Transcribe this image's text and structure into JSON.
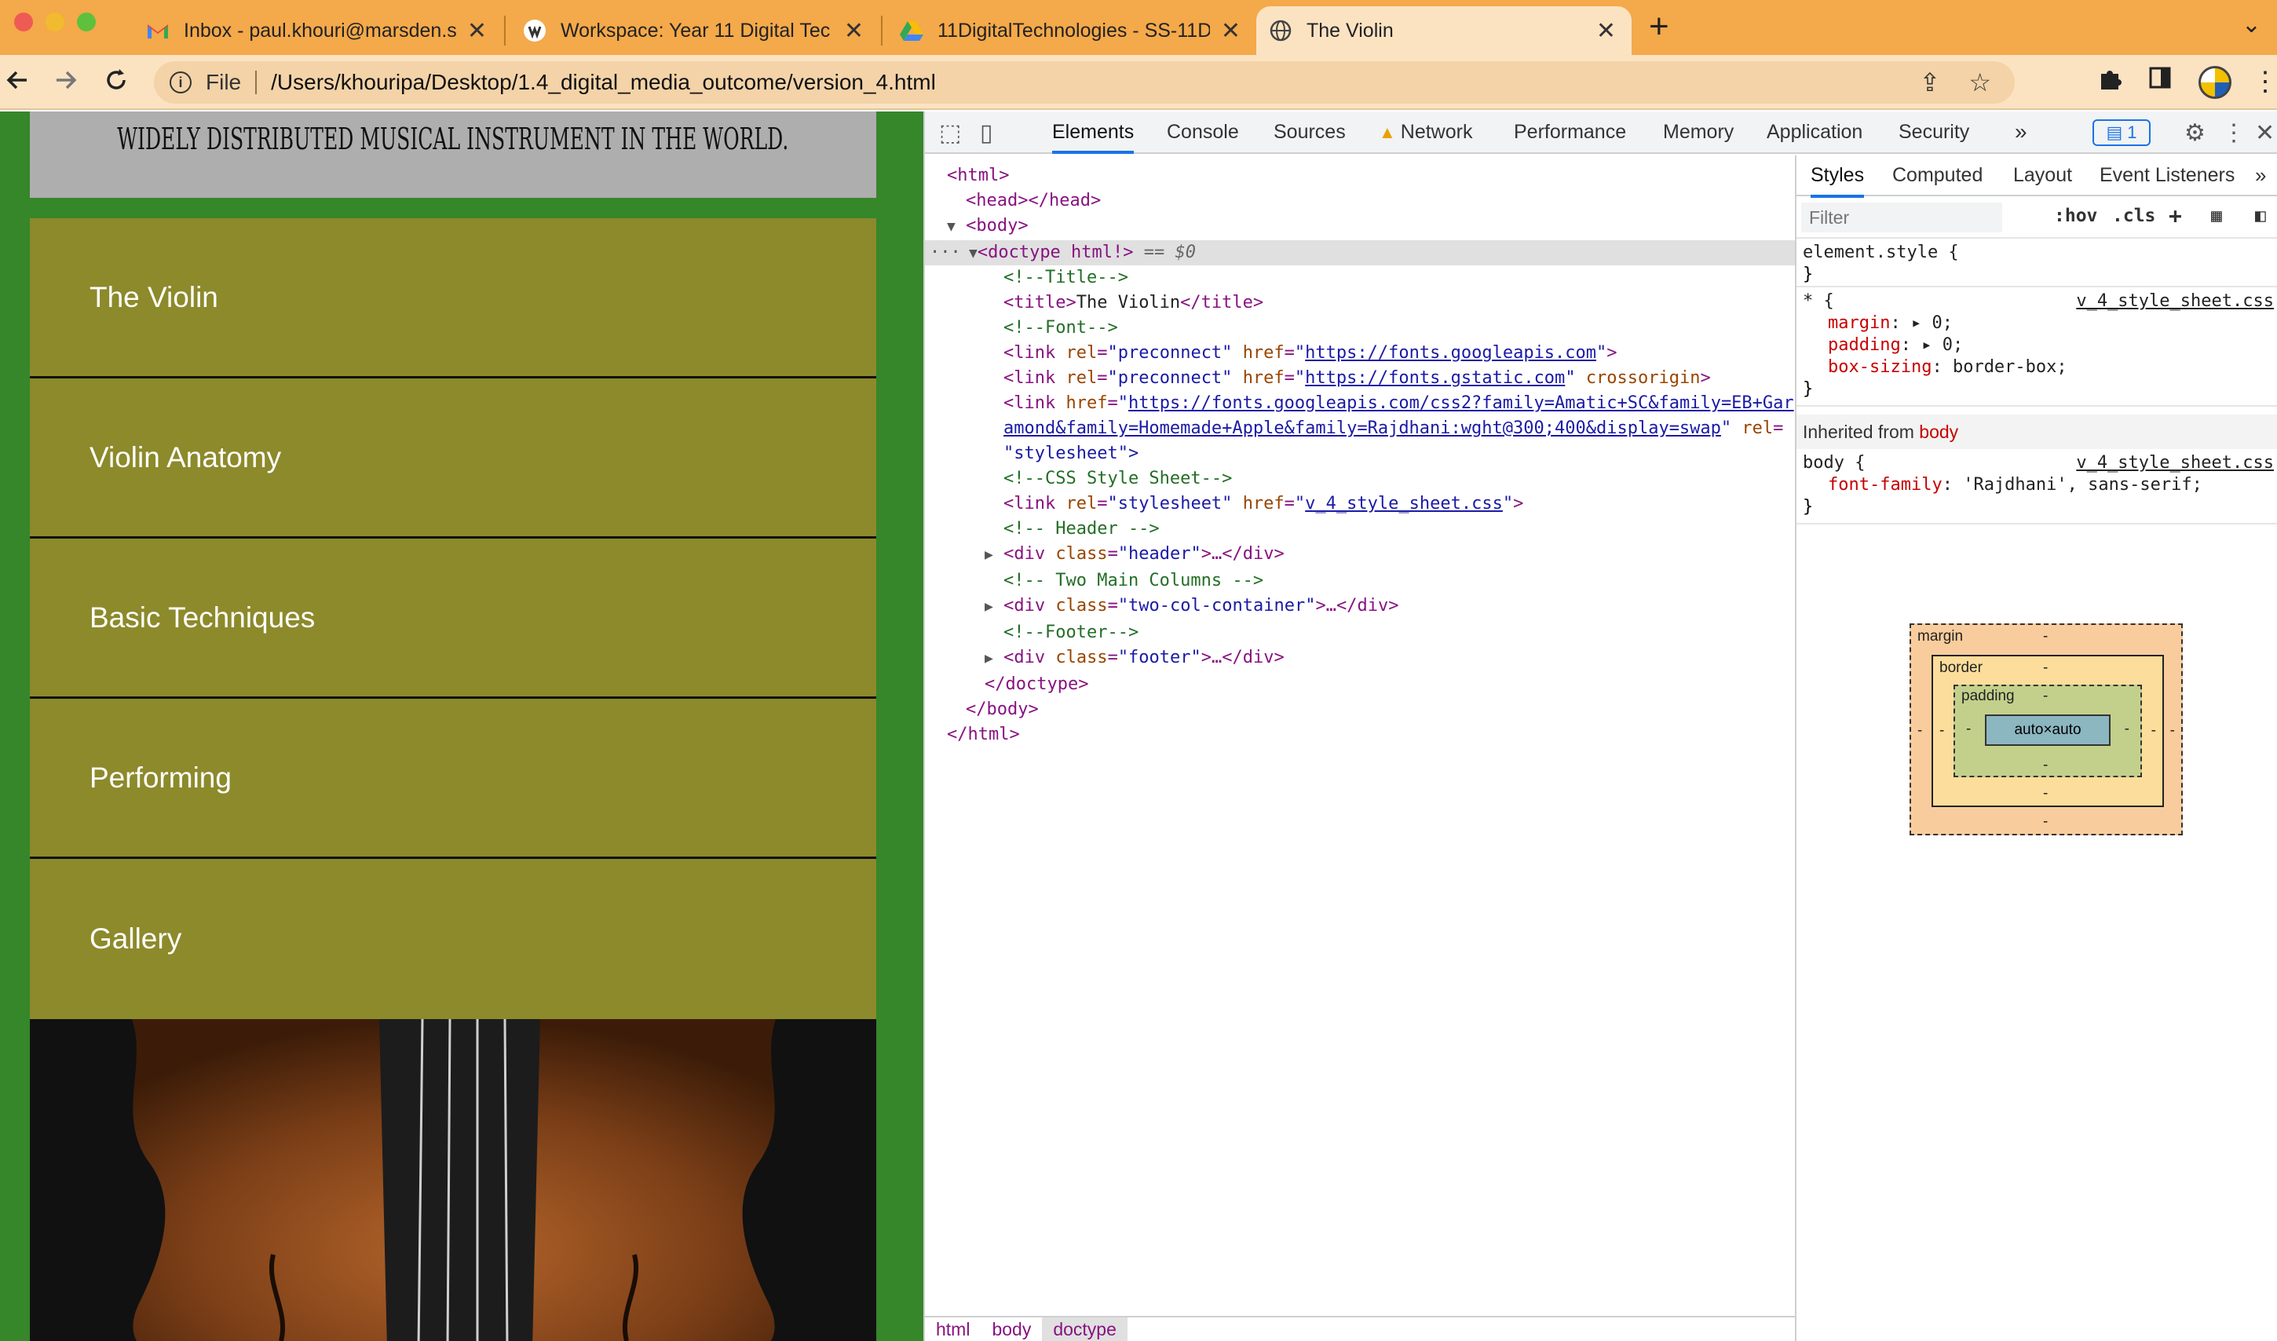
{
  "browser": {
    "tabs": [
      {
        "title": "Inbox - paul.khouri@marsden.s",
        "icon": "gmail-icon"
      },
      {
        "title": "Workspace: Year 11 Digital Tec",
        "icon": "workspace-icon"
      },
      {
        "title": "11DigitalTechnologies - SS-11D",
        "icon": "google-drive-icon"
      },
      {
        "title": "The Violin",
        "icon": "globe-icon"
      }
    ],
    "close_glyph": "✕",
    "new_tab_glyph": "+",
    "address": {
      "scheme_label": "File",
      "url": "/Users/khouripa/Desktop/1.4_digital_media_outcome/version_4.html"
    }
  },
  "page": {
    "header_text": "WIDELY DISTRIBUTED MUSICAL INSTRUMENT IN THE WORLD.",
    "nav_items": [
      "The Violin",
      "Violin Anatomy",
      "Basic Techniques",
      "Performing",
      "Gallery"
    ],
    "colors": {
      "background": "#36862a",
      "nav": "#8c8a2b",
      "header": "#aeaeae"
    }
  },
  "devtools": {
    "tabs": [
      "Elements",
      "Console",
      "Sources",
      "Network",
      "Performance",
      "Memory",
      "Application",
      "Security"
    ],
    "active_tab": "Elements",
    "more_tabs": "»",
    "issues_count": "1",
    "dom_lines": {
      "l1": "<html>",
      "l2": "<head></head>",
      "l3": "<body>",
      "l4_tag": "<doctype html!>",
      "l4_eq": "== $0",
      "l5": "<!--Title-->",
      "l6_open": "<title>",
      "l6_text": "The Violin",
      "l6_close": "</title>",
      "l7": "<!--Font-->",
      "l8_href": "https://fonts.googleapis.com",
      "l9_href": "https://fonts.gstatic.com",
      "l10_href_a": "https://fonts.googleapis.com/css2?family=Amatic+SC&family=EB+Gar",
      "l10_href_b": "amond&family=Homemade+Apple&family=Rajdhani:wght@300;400&display=swap",
      "l10_rel": "\"stylesheet\">",
      "l11": "<!--CSS Style Sheet-->",
      "l12_href": "v_4_style_sheet.css",
      "l13": "<!-- Header -->",
      "l14_class": "\"header\"",
      "l15": "<!-- Two Main Columns -->",
      "l16_class": "\"two-col-container\"",
      "l17": "<!--Footer-->",
      "l18_class": "\"footer\"",
      "l19": "</doctype>",
      "l20": "</body>",
      "l21": "</html>"
    },
    "breadcrumbs": [
      "html",
      "body",
      "doctype"
    ],
    "styles": {
      "tabs": [
        "Styles",
        "Computed",
        "Layout",
        "Event Listeners"
      ],
      "filter_placeholder": "Filter",
      "hov": ":hov",
      "cls": ".cls",
      "element_style": "element.style {",
      "universal_selector": "* {",
      "source": "v_4_style_sheet.css",
      "props": [
        {
          "name": "margin",
          "value": "0;"
        },
        {
          "name": "padding",
          "value": "0;"
        },
        {
          "name": "box-sizing",
          "value": "border-box;"
        }
      ],
      "inherited_label": "Inherited from",
      "inherited_from": "body",
      "body_selector": "body {",
      "body_prop": {
        "name": "font-family",
        "value": "'Rajdhani', sans-serif;"
      },
      "box_model": {
        "margin": "margin",
        "border": "border",
        "padding": "padding",
        "content": "auto×auto",
        "dash": "-"
      }
    }
  }
}
